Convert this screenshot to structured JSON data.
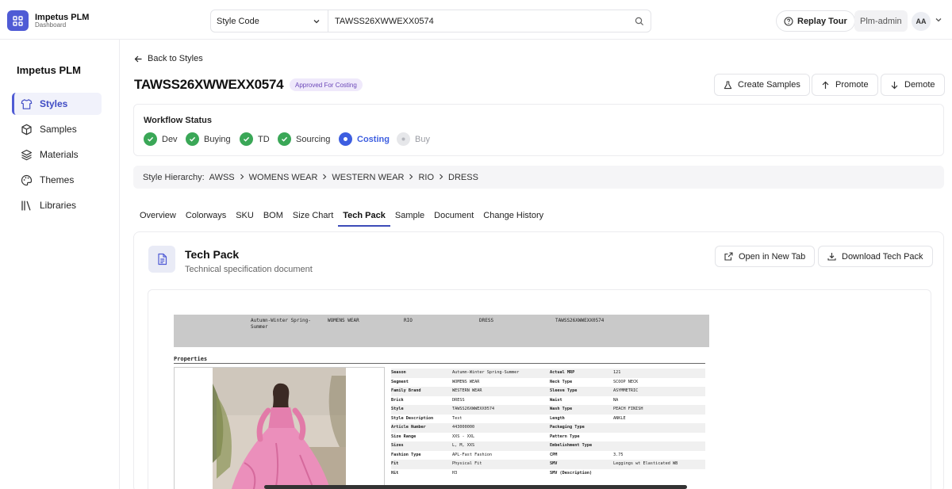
{
  "app": {
    "name": "Impetus PLM",
    "subtitle": "Dashboard"
  },
  "header": {
    "search_type": "Style Code",
    "search_value": "TAWSS26XWWEXX0574",
    "replay_tour": "Replay Tour",
    "user_role": "Plm-admin",
    "avatar_initials": "AA"
  },
  "sidebar": {
    "brand": "Impetus PLM",
    "items": [
      {
        "label": "Styles",
        "icon": "shirt-icon"
      },
      {
        "label": "Samples",
        "icon": "box-icon"
      },
      {
        "label": "Materials",
        "icon": "layers-icon"
      },
      {
        "label": "Themes",
        "icon": "palette-icon"
      },
      {
        "label": "Libraries",
        "icon": "library-icon"
      }
    ],
    "active": "Styles"
  },
  "page": {
    "back": "Back to Styles",
    "style_code": "TAWSS26XWWEXX0574",
    "status_badge": "Approved For Costing",
    "actions": {
      "create_samples": "Create Samples",
      "promote": "Promote",
      "demote": "Demote"
    }
  },
  "workflow": {
    "title": "Workflow Status",
    "steps": [
      {
        "label": "Dev",
        "state": "done"
      },
      {
        "label": "Buying",
        "state": "done"
      },
      {
        "label": "TD",
        "state": "done"
      },
      {
        "label": "Sourcing",
        "state": "done"
      },
      {
        "label": "Costing",
        "state": "current"
      },
      {
        "label": "Buy",
        "state": "pending"
      }
    ],
    "colors": {
      "done": "#3aa757",
      "current": "#3d5ee0",
      "pending": "#e6e7ea"
    }
  },
  "hierarchy": {
    "label": "Style Hierarchy:",
    "path": [
      "AWSS",
      "WOMENS WEAR",
      "WESTERN WEAR",
      "RIO",
      "DRESS"
    ]
  },
  "tabs": [
    "Overview",
    "Colorways",
    "SKU",
    "BOM",
    "Size Chart",
    "Tech Pack",
    "Sample",
    "Document",
    "Change History"
  ],
  "active_tab": "Tech Pack",
  "techpack": {
    "title": "Tech Pack",
    "subtitle": "Technical specification document",
    "open_new_tab": "Open in New Tab",
    "download": "Download Tech Pack"
  },
  "document": {
    "header": [
      "Autumn-Winter Spring-Summer",
      "WOMENS WEAR",
      "RIO",
      "DRESS",
      "TAWSS26XWWEXX0574"
    ],
    "properties_title": "Properties",
    "rows": [
      [
        "Season",
        "Autumn-Winter Spring-Summer",
        "Actual MRP",
        "121"
      ],
      [
        "Segment",
        "WOMENS WEAR",
        "Neck Type",
        "SCOOP NECK"
      ],
      [
        "Family Brand",
        "WESTERN WEAR",
        "Sleeve Type",
        "ASYMMETRIC"
      ],
      [
        "Brick",
        "DRESS",
        "Waist",
        "NA"
      ],
      [
        "Style",
        "TAWSS26XWWEXX0574",
        "Wash Type",
        "PEACH FINISH"
      ],
      [
        "Style Description",
        "Test",
        "Length",
        "ANKLE"
      ],
      [
        "Article Number",
        "443000000",
        "Packaging Type",
        ""
      ],
      [
        "Size Range",
        "XXS - XXL",
        "Pattern Type",
        ""
      ],
      [
        "Sizes",
        "L, M, XXS",
        "Embelishment Type",
        ""
      ],
      [
        "Fashion Type",
        "APL-Fast Fashion",
        "CPM",
        "3.75"
      ],
      [
        "Fit",
        "Physical Fit",
        "SMV",
        "Leggings wt Elasticated WB"
      ],
      [
        "Hit",
        "H3",
        "SMV (Description)",
        ""
      ]
    ]
  },
  "accent_color": "#4f5bd5"
}
